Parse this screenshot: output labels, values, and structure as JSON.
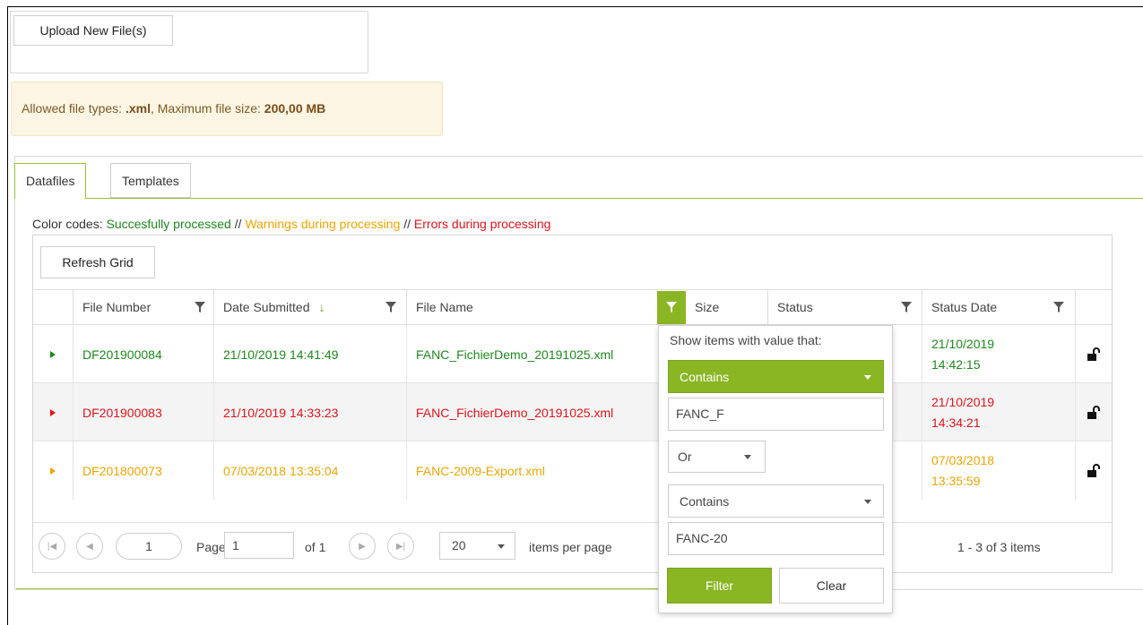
{
  "upload": {
    "button_label": "Upload New File(s)"
  },
  "info": {
    "prefix": "Allowed file types: ",
    "types": ".xml",
    "middle": ", Maximum file size: ",
    "max_size": "200,00 MB"
  },
  "tabs": [
    {
      "label": "Datafiles",
      "active": true
    },
    {
      "label": "Templates",
      "active": false
    }
  ],
  "color_codes": {
    "prefix": "Color codes: ",
    "success": "Succesfully processed",
    "sep1": " // ",
    "warning": "Warnings during processing",
    "sep2": " // ",
    "error": "Errors during processing"
  },
  "toolbar": {
    "refresh_label": "Refresh Grid"
  },
  "columns": {
    "file_number": "File Number",
    "date_submitted": "Date Submitted",
    "file_name": "File Name",
    "size": "Size",
    "status": "Status",
    "status_date": "Status Date"
  },
  "rows": [
    {
      "file_number": "DF201900084",
      "date_submitted": "21/10/2019 14:41:49",
      "file_name": "FANC_FichierDemo_20191025.xml",
      "status_date_1": "21/10/2019",
      "status_date_2": "14:42:15",
      "state": "success"
    },
    {
      "file_number": "DF201900083",
      "date_submitted": "21/10/2019 14:33:23",
      "file_name": "FANC_FichierDemo_20191025.xml",
      "status_date_1": "21/10/2019",
      "status_date_2": "14:34:21",
      "state": "error"
    },
    {
      "file_number": "DF201800073",
      "date_submitted": "07/03/2018 13:35:04",
      "file_name": "FANC-2009-Export.xml",
      "status_date_1": "07/03/2018",
      "status_date_2": "13:35:59",
      "state": "warning"
    }
  ],
  "pager": {
    "current_page": "1",
    "page_label": "Page",
    "page_input": "1",
    "of_label": "of 1",
    "page_size": "20",
    "items_per_page": "items per page",
    "summary": "1 - 3 of 3 items"
  },
  "filter_popup": {
    "label": "Show items with value that:",
    "operator1": "Contains",
    "value1": "FANC_F",
    "logic": "Or",
    "operator2": "Contains",
    "value2": "FANC-20",
    "filter_label": "Filter",
    "clear_label": "Clear"
  },
  "colors": {
    "success": "#1c8a1c",
    "warning": "#f0a400",
    "error": "#e3131b",
    "accent": "#8ab624"
  }
}
